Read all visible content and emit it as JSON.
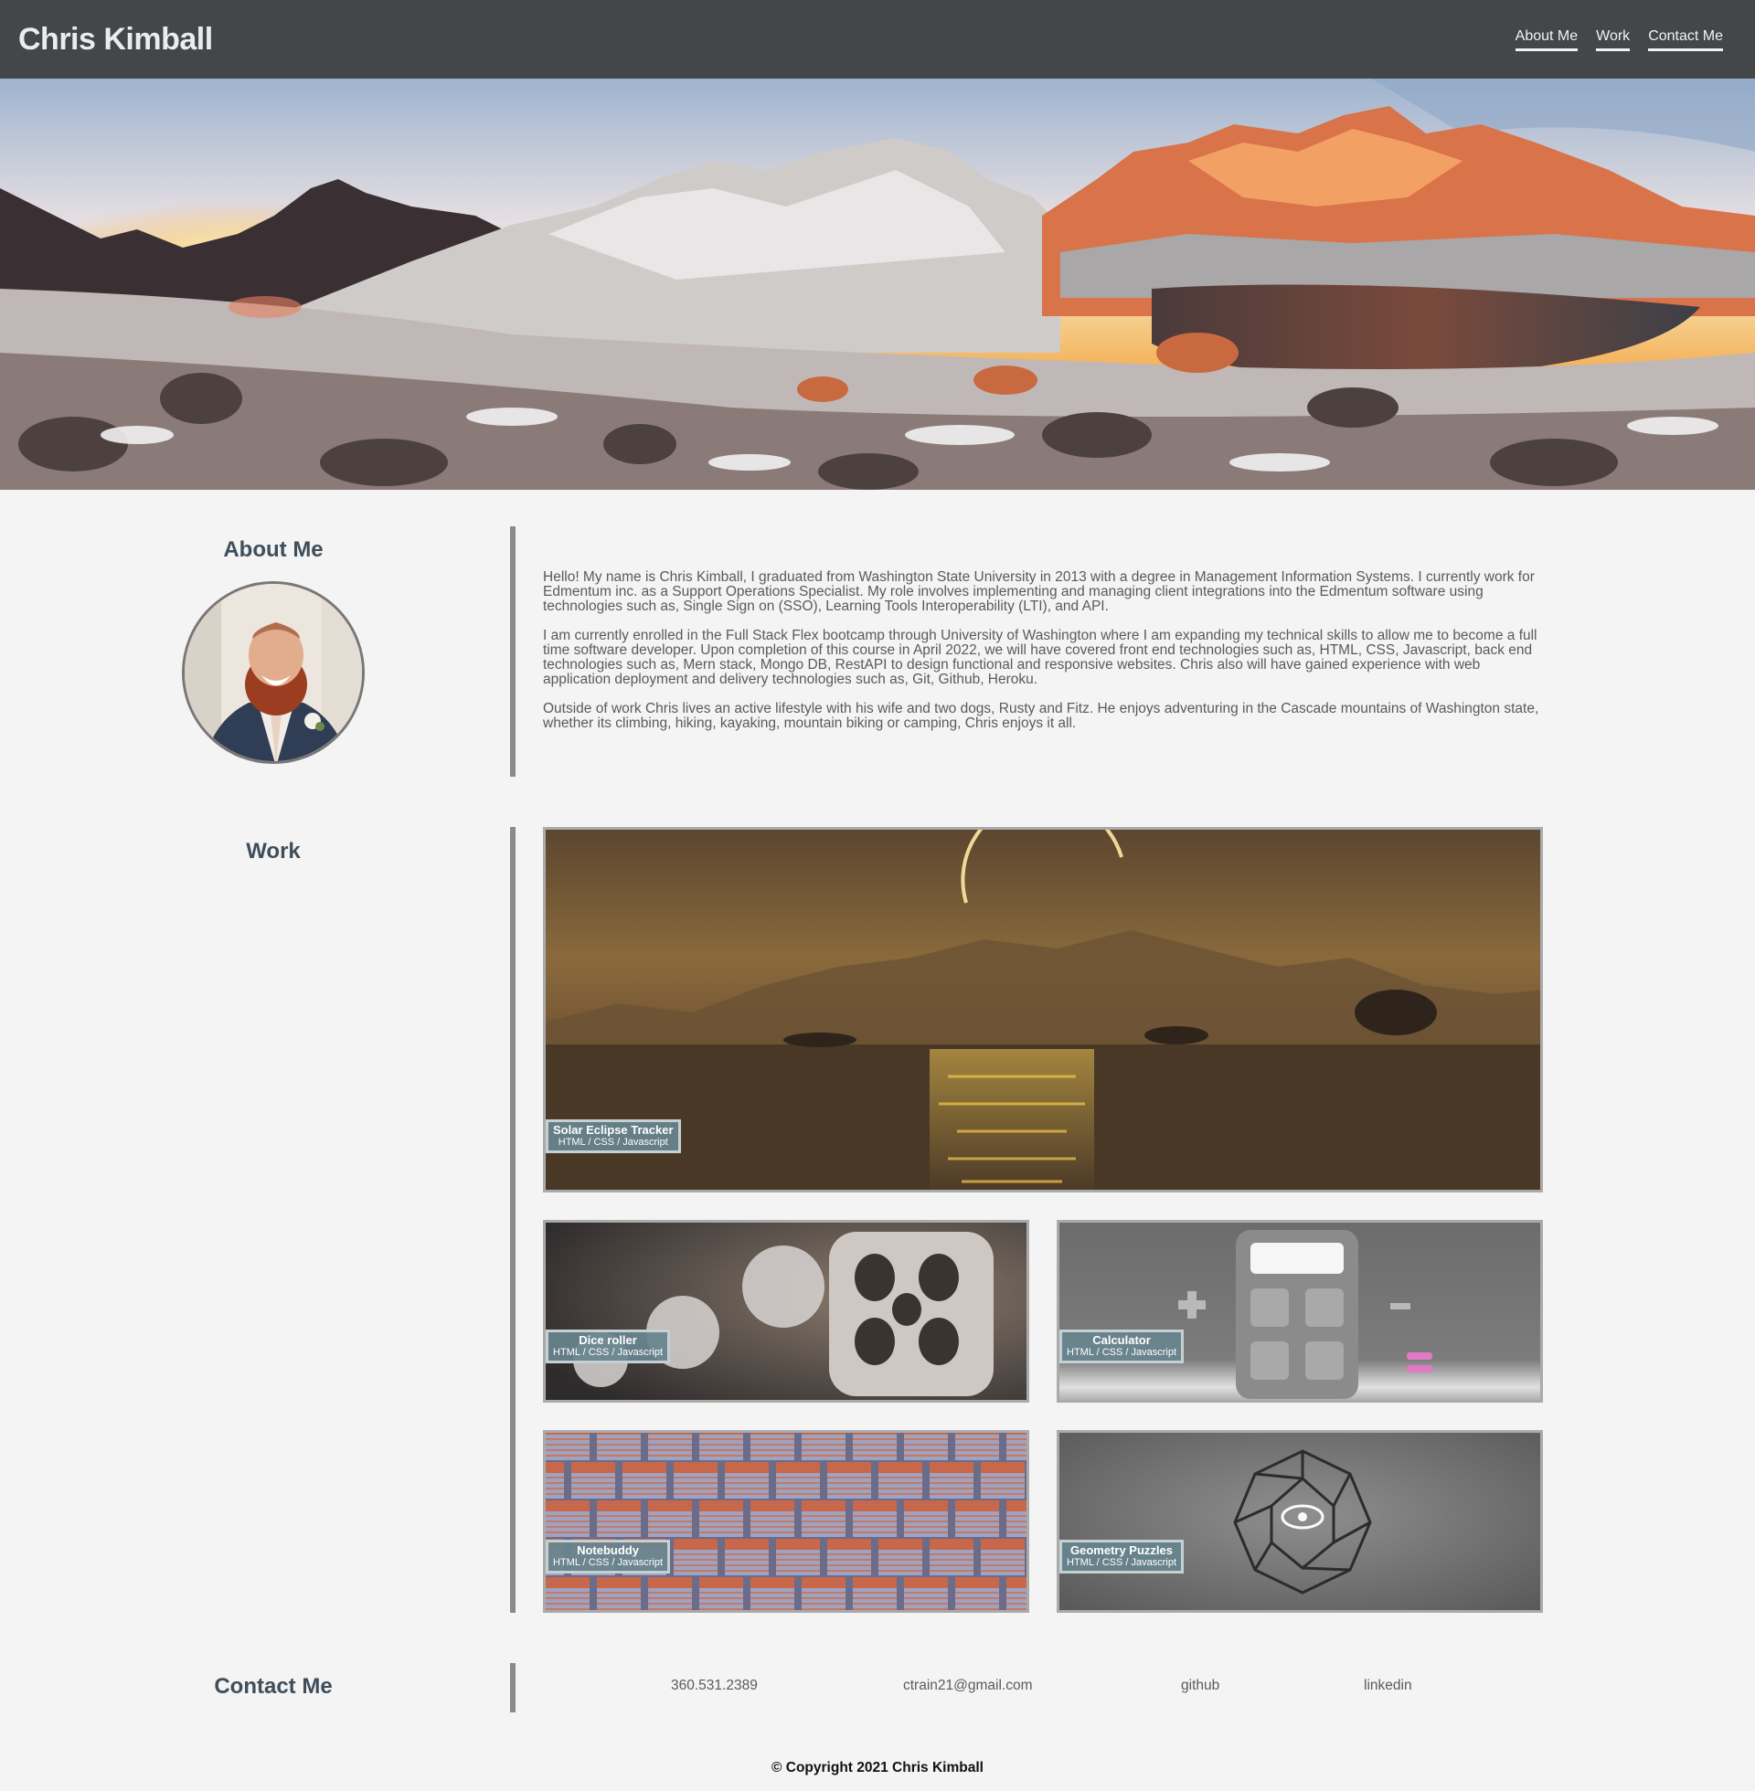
{
  "header": {
    "title": "Chris Kimball",
    "nav": [
      "About Me",
      "Work",
      "Contact Me"
    ]
  },
  "about": {
    "heading": "About Me",
    "paragraphs": [
      "Hello! My name is Chris Kimball, I graduated from Washington State University in 2013 with a degree in Management Information Systems. I currently work for Edmentum inc. as a Support Operations Specialist. My role involves implementing and managing client integrations into the Edmentum software using technologies such as, Single Sign on (SSO), Learning Tools Interoperability (LTI), and API.",
      "I am currently enrolled in the Full Stack Flex bootcamp through University of Washington where I am expanding my technical skills to allow me to become a full time software developer. Upon completion of this course in April 2022, we will have covered front end technologies such as, HTML, CSS, Javascript, back end technologies such as, Mern stack, Mongo DB, RestAPI to design functional and responsive websites. Chris also will have gained experience with web application deployment and delivery technologies such as, Git, Github, Heroku.",
      "Outside of work Chris lives an active lifestyle with his wife and two dogs, Rusty and Fitz. He enjoys adventuring in the Cascade mountains of Washington state, whether its climbing, hiking, kayaking, mountain biking or camping, Chris enjoys it all."
    ]
  },
  "work": {
    "heading": "Work",
    "projects": [
      {
        "name": "Solar Eclipse Tracker",
        "tech": "HTML / CSS / Javascript"
      },
      {
        "name": "Dice roller",
        "tech": "HTML / CSS / Javascript"
      },
      {
        "name": "Calculator",
        "tech": "HTML / CSS / Javascript"
      },
      {
        "name": "Notebuddy",
        "tech": "HTML / CSS / Javascript"
      },
      {
        "name": "Geometry Puzzles",
        "tech": "HTML / CSS / Javascript"
      }
    ]
  },
  "contact": {
    "heading": "Contact Me",
    "phone": "360.531.2389",
    "email": "ctrain21@gmail.com",
    "github": "github",
    "linkedin": "linkedin"
  },
  "footer": {
    "copyright": "© Copyright 2021 Chris Kimball"
  }
}
